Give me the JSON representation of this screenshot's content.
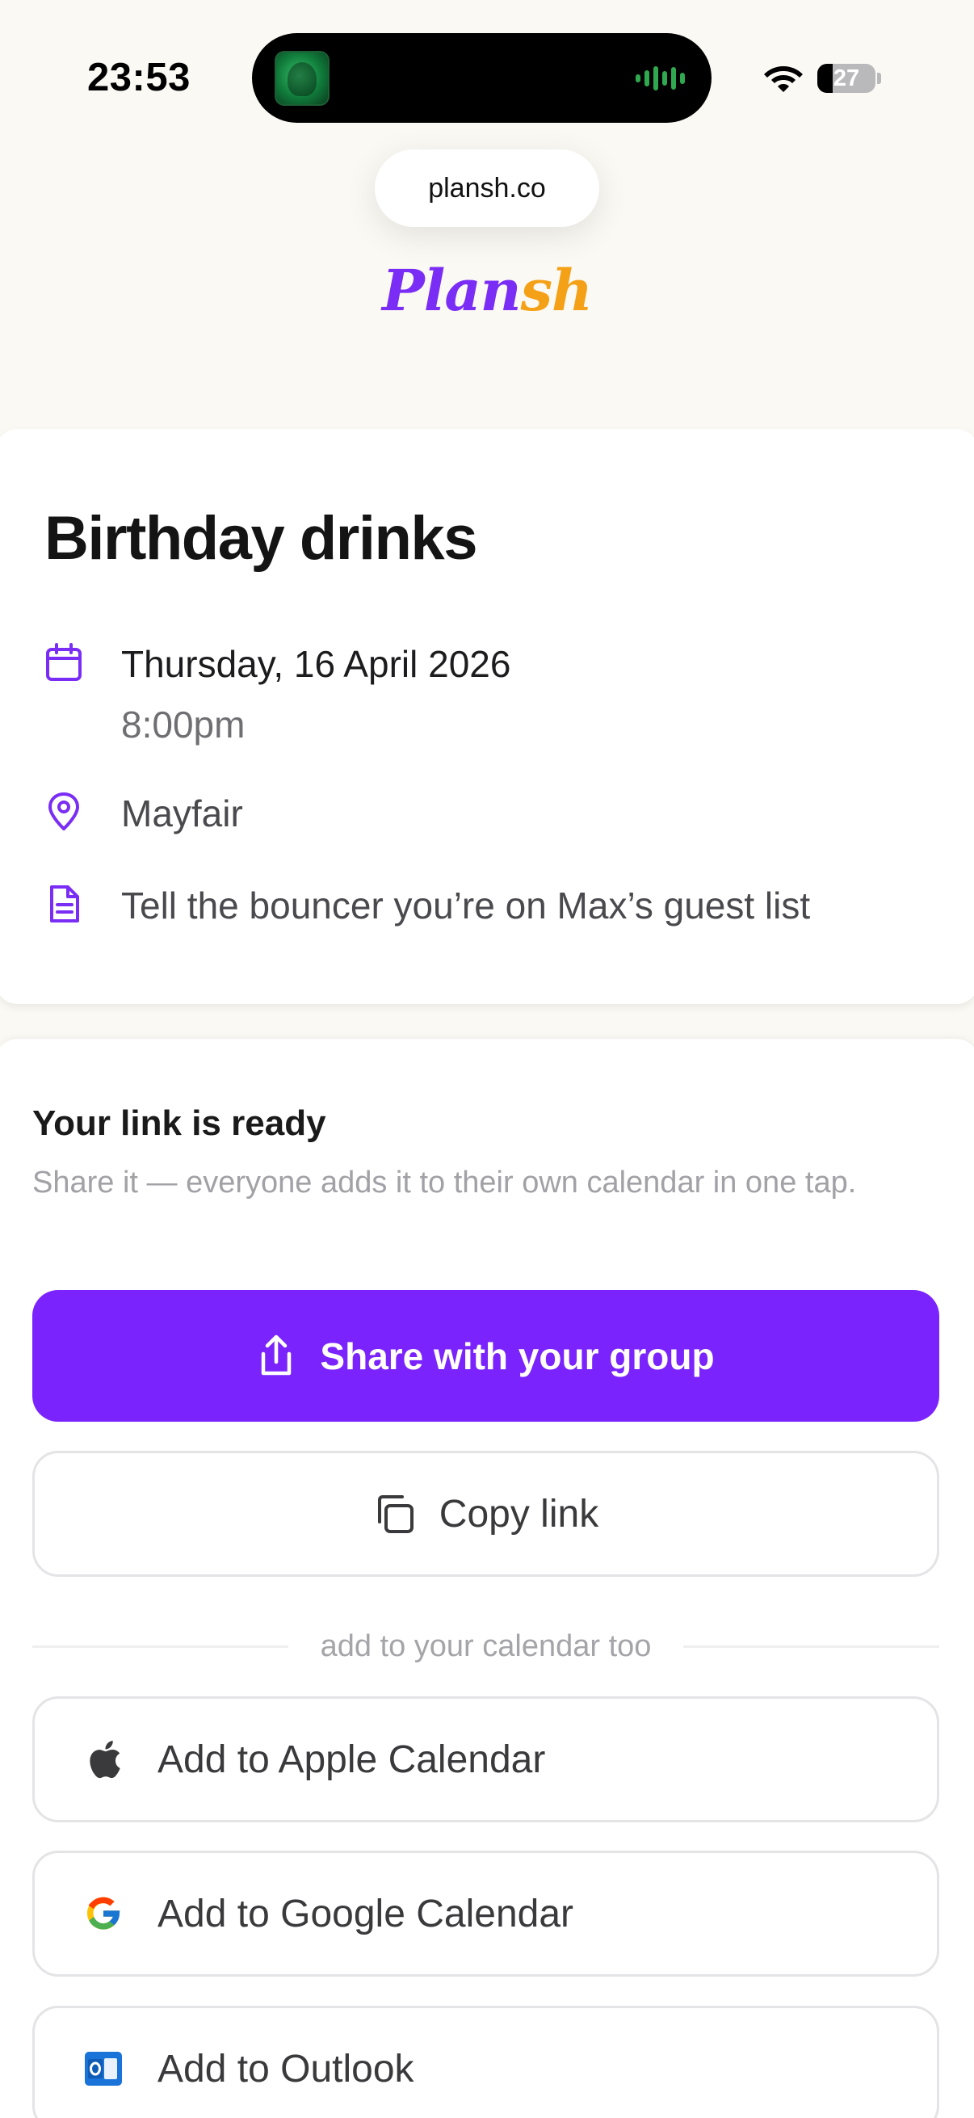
{
  "status_bar": {
    "time": "23:53",
    "battery_level": "27"
  },
  "browser": {
    "url": "plansh.co"
  },
  "brand": {
    "logo_part_a": "Plan",
    "logo_part_b": "sh",
    "accent_purple": "#7a23fc",
    "accent_orange": "#f5a117"
  },
  "event": {
    "title": "Birthday drinks",
    "date": "Thursday, 16 April 2026",
    "time": "8:00pm",
    "location": "Mayfair",
    "note": "Tell the bouncer you’re on Max’s guest list",
    "icons": [
      "calendar-icon",
      "location-pin-icon",
      "note-icon"
    ]
  },
  "share": {
    "title": "Your link is ready",
    "subtitle": "Share it — everyone adds it to their own calendar in one tap.",
    "share_button": "Share with your group",
    "copy_button": "Copy link",
    "divider": "add to your calendar too",
    "calendar_buttons": [
      {
        "label": "Add to Apple Calendar",
        "icon": "apple-icon"
      },
      {
        "label": "Add to Google Calendar",
        "icon": "google-icon"
      },
      {
        "label": "Add to Outlook",
        "icon": "outlook-icon"
      }
    ]
  }
}
